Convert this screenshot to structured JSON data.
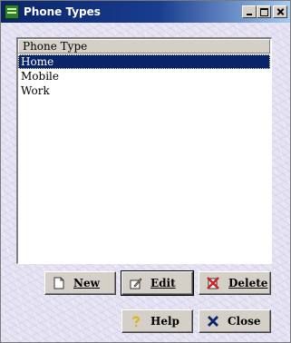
{
  "window": {
    "title": "Phone Types"
  },
  "list": {
    "column_header": "Phone Type",
    "rows": [
      {
        "label": "Home",
        "selected": true
      },
      {
        "label": "Mobile",
        "selected": false
      },
      {
        "label": "Work",
        "selected": false
      }
    ]
  },
  "buttons": {
    "new_label": "New",
    "edit_label": "Edit",
    "delete_label": "Delete",
    "help_label": "Help",
    "close_label": "Close"
  },
  "icons": {
    "app": "phone-types-app-icon",
    "new": "new-document-icon",
    "edit": "edit-pencil-icon",
    "delete": "delete-x-icon",
    "help": "question-mark-icon",
    "close": "close-x-icon"
  },
  "colors": {
    "titlebar_start": "#0a246a",
    "titlebar_end": "#a6caf0",
    "selection": "#0a246a",
    "delete_icon": "#cc2222",
    "close_icon": "#0a246a",
    "help_icon": "#e0b020"
  }
}
